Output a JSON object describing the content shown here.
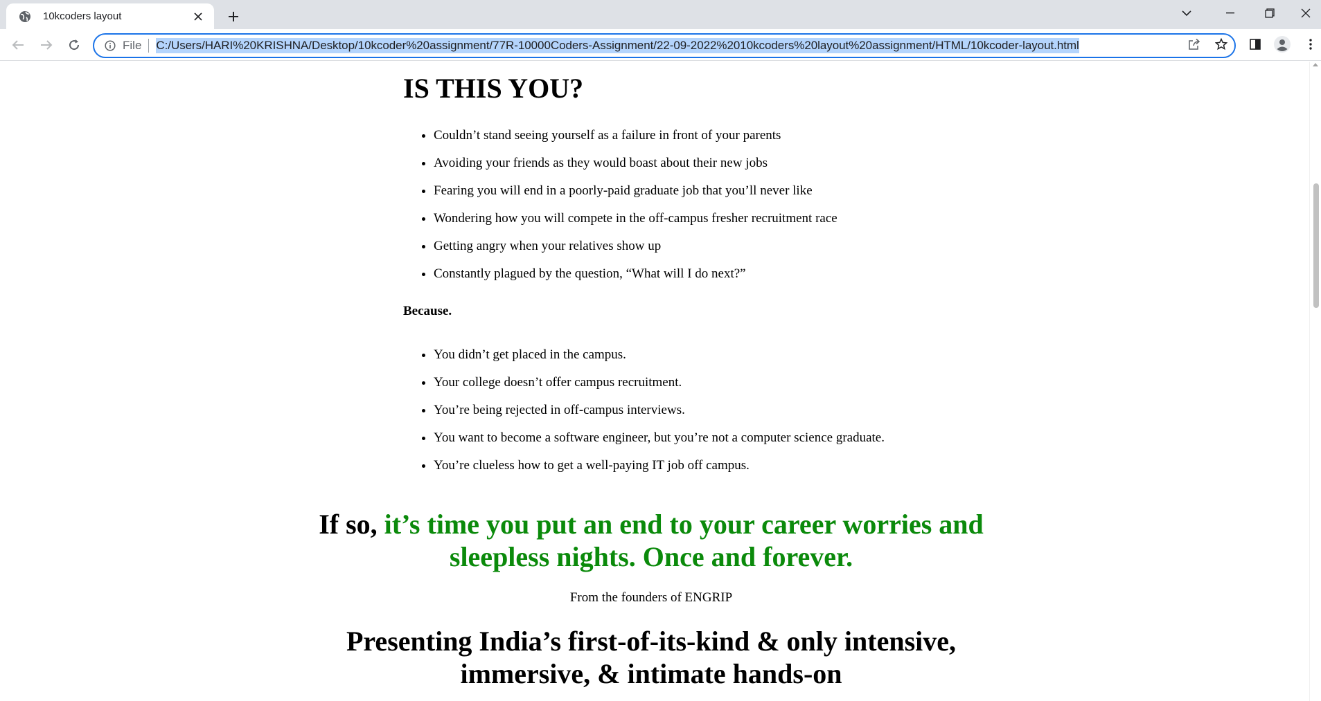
{
  "browser": {
    "tab_title": "10kcoders layout",
    "scheme_label": "File",
    "url": "C:/Users/HARI%20KRISHNA/Desktop/10kcoder%20assignment/77R-10000Coders-Assignment/22-09-2022%2010kcoders%20layout%20assignment/HTML/10kcoder-layout.html",
    "accent_color": "#1a73e8",
    "selection_color": "#b4d4fc"
  },
  "page": {
    "heading": "IS THIS YOU?",
    "worries": [
      "Couldn’t stand seeing yourself as a failure in front of your parents",
      "Avoiding your friends as they would boast about their new jobs",
      "Fearing you will end in a poorly-paid graduate job that you’ll never like",
      "Wondering how you will compete in the off-campus fresher recruitment race",
      "Getting angry when your relatives show up",
      "Constantly plagued by the question, “What will I do next?”"
    ],
    "because_label": "Because.",
    "reasons": [
      "You didn’t get placed in the campus.",
      "Your college doesn’t offer campus recruitment.",
      "You’re being rejected in off-campus interviews.",
      "You want to become a software engineer, but you’re not a computer science graduate.",
      "You’re clueless how to get a well-paying IT job off campus."
    ],
    "cta_lead": "If so, ",
    "cta_green": "it’s time you put an end to your career worries and sleepless nights. Once and forever.",
    "cta_color": "#0b8a0b",
    "founders_line": "From the founders of ENGRIP",
    "presenting": "Presenting India’s first-of-its-kind & only intensive, immersive, & intimate hands-on"
  }
}
